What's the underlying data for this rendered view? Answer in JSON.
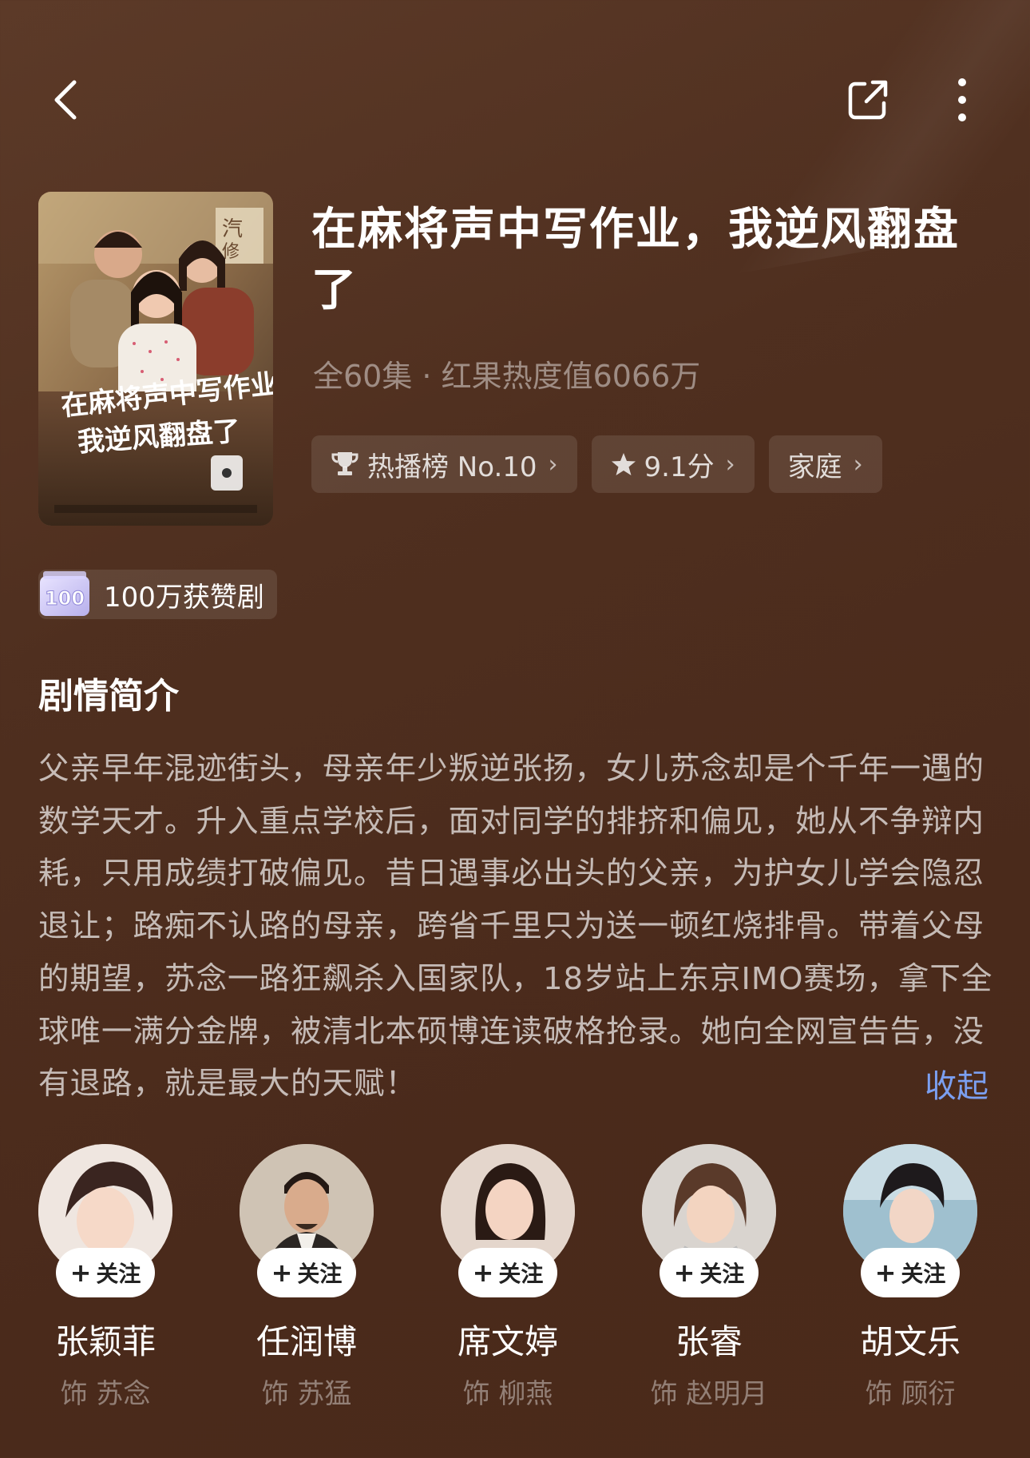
{
  "nav": {
    "back_icon": "chevron-left-icon",
    "share_icon": "share-icon",
    "more_icon": "more-vertical-icon"
  },
  "drama": {
    "title": "在麻将声中写作业，我逆风翻盘了",
    "meta": "全60集 · 红果热度值6066万",
    "poster_text": "在麻将声中写作业，我逆风翻盘了",
    "tags": [
      {
        "icon": "trophy-icon",
        "label": "热播榜 No.10"
      },
      {
        "icon": "star-icon",
        "label": "9.1分"
      },
      {
        "icon": "",
        "label": "家庭"
      }
    ],
    "badge": {
      "icon_text": "100",
      "label": "100万获赞剧"
    }
  },
  "synopsis": {
    "heading": "剧情简介",
    "text": "父亲早年混迹街头，母亲年少叛逆张扬，女儿苏念却是个千年一遇的数学天才。升入重点学校后，面对同学的排挤和偏见，她从不争辩内耗，只用成绩打破偏见。昔日遇事必出头的父亲，为护女儿学会隐忍退让；路痴不认路的母亲，跨省千里只为送一顿红烧排骨。带着父母的期望，苏念一路狂飙杀入国家队，18岁站上东京IMO赛场，拿下全球唯一满分金牌，被清北本硕博连读破格抢录。她向全网宣告告，没有退路，就是最大的天赋！",
    "collapse_label": "收起"
  },
  "cast": [
    {
      "name": "张颖菲",
      "role": "饰 苏念",
      "follow": "关注"
    },
    {
      "name": "任润博",
      "role": "饰 苏猛",
      "follow": "关注"
    },
    {
      "name": "席文婷",
      "role": "饰 柳燕",
      "follow": "关注"
    },
    {
      "name": "张睿",
      "role": "饰 赵明月",
      "follow": "关注"
    },
    {
      "name": "胡文乐",
      "role": "饰 顾衍",
      "follow": "关注"
    }
  ],
  "colors": {
    "background": "#4f2f1f",
    "link": "#7b9ff0",
    "follow_bg": "#ffffff"
  }
}
